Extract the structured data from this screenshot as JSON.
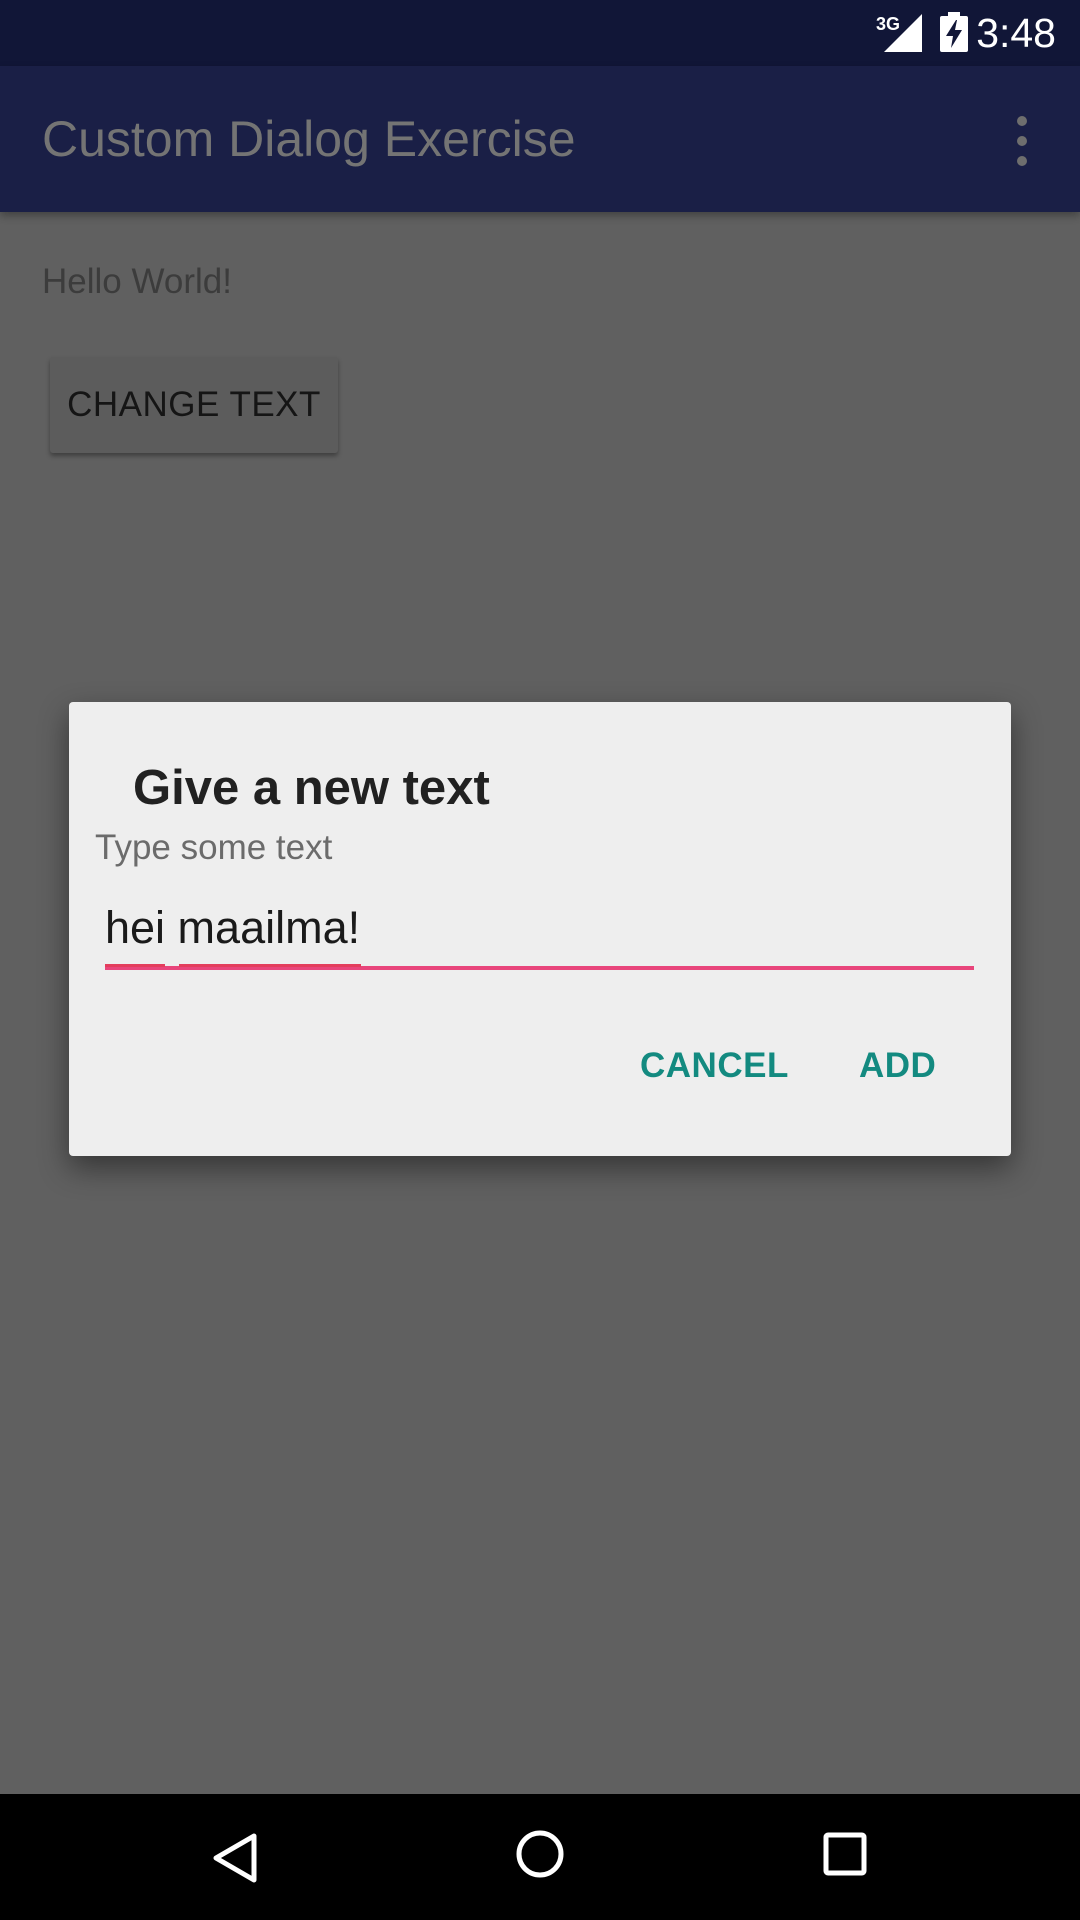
{
  "status_bar": {
    "network": "3G",
    "time": "3:48"
  },
  "app_bar": {
    "title": "Custom Dialog Exercise",
    "overflow_icon": "more-vert-icon"
  },
  "content": {
    "hello_text": "Hello World!",
    "change_button": "CHANGE TEXT"
  },
  "dialog": {
    "title": "Give a new text",
    "hint": "Type some text",
    "input_value": "hei maailma!",
    "cancel_label": "CANCEL",
    "add_label": "ADD"
  },
  "nav_bar": {
    "back": "back-icon",
    "home": "home-icon",
    "recents": "recents-icon"
  },
  "colors": {
    "status_bar": "#111637",
    "app_bar": "#1a1f46",
    "scrim": "#606060",
    "dialog_bg": "#eeeeee",
    "accent": "#138a80",
    "input_underline": "#e8457b"
  }
}
